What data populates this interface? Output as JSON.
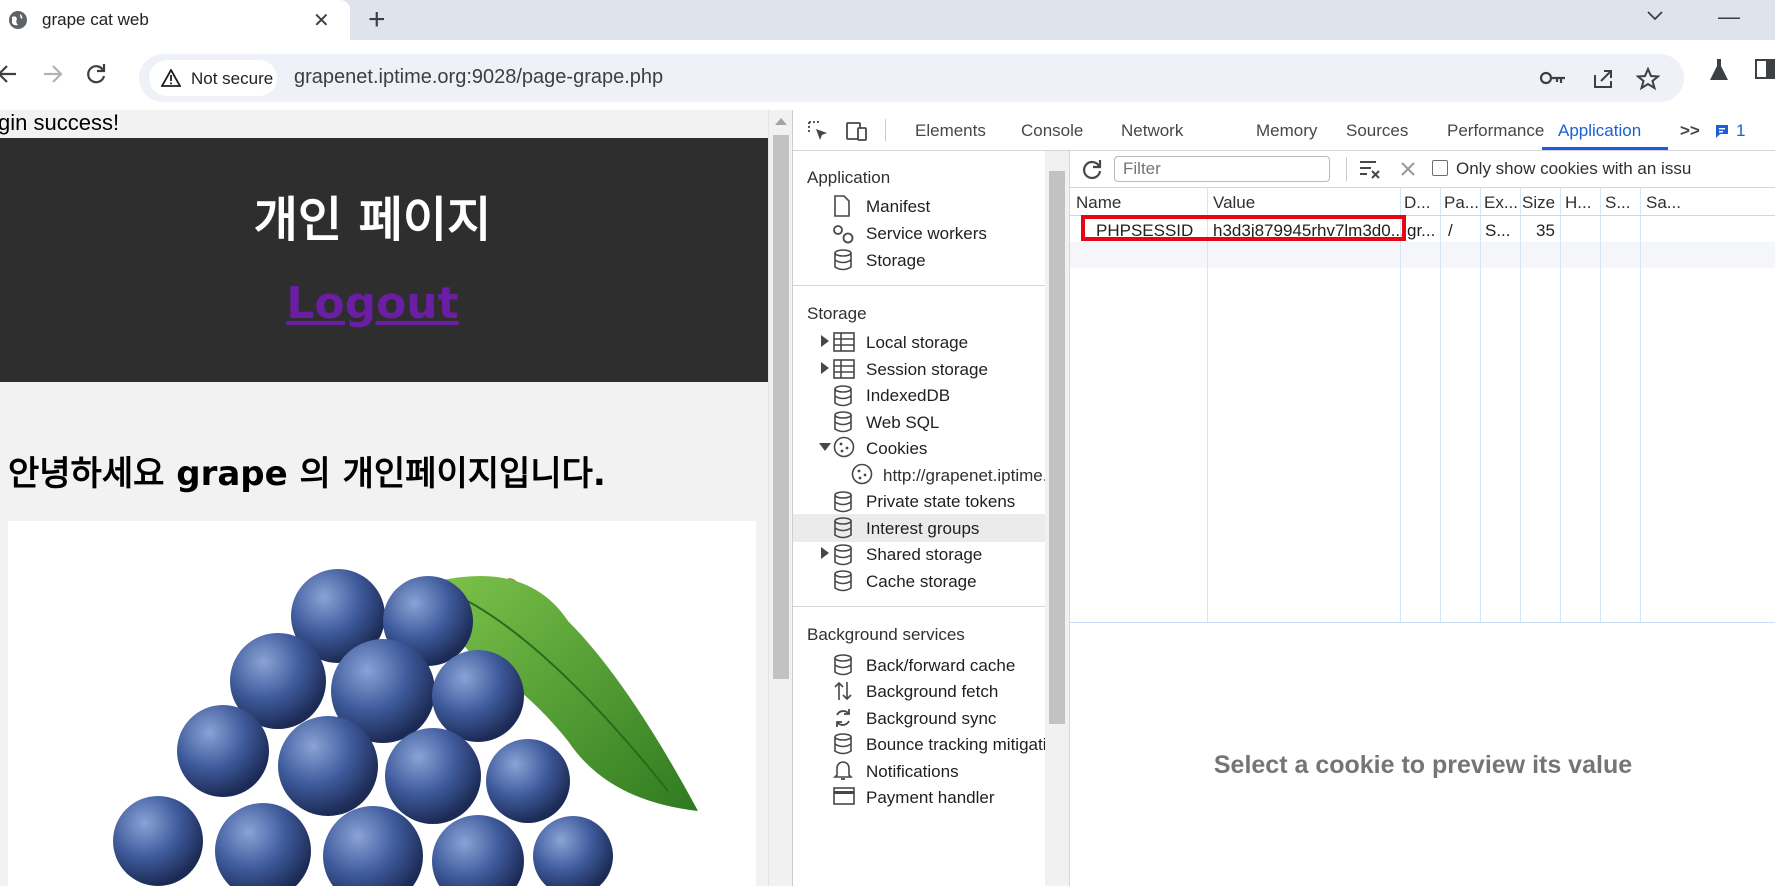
{
  "browser": {
    "tab_title": "grape cat web",
    "security_label": "Not secure",
    "url": "grapenet.iptime.org:9028/page-grape.php"
  },
  "page": {
    "login_message": "gin success!",
    "banner_title": "개인 페이지",
    "logout_link": "Logout",
    "greeting": "안녕하세요 grape 의 개인페이지입니다."
  },
  "devtools": {
    "tabs": [
      "Elements",
      "Console",
      "Network",
      "Memory",
      "Sources",
      "Performance",
      "Application"
    ],
    "active_tab": "Application",
    "more_tabs": ">>",
    "issues_count": "1",
    "sidebar": {
      "application_header": "Application",
      "application_items": [
        "Manifest",
        "Service workers",
        "Storage"
      ],
      "storage_header": "Storage",
      "storage_items": [
        "Local storage",
        "Session storage",
        "IndexedDB",
        "Web SQL",
        "Cookies",
        "http://grapenet.iptime.o",
        "Private state tokens",
        "Interest groups",
        "Shared storage",
        "Cache storage"
      ],
      "background_header": "Background services",
      "background_items": [
        "Back/forward cache",
        "Background fetch",
        "Background sync",
        "Bounce tracking mitigatio",
        "Notifications",
        "Payment handler"
      ]
    },
    "cookies": {
      "filter_placeholder": "Filter",
      "only_show_label": "Only show cookies with an issu",
      "columns": [
        "Name",
        "Value",
        "D...",
        "Pa...",
        "Ex...",
        "Size",
        "H...",
        "S...",
        "Sa..."
      ],
      "row": {
        "name": "PHPSESSID",
        "value": "h3d3j879945rhv7lm3d0...",
        "domain": "gr...",
        "path": "/",
        "expires": "S...",
        "size": "35"
      },
      "preview_text": "Select a cookie to preview its value"
    }
  },
  "colors": {
    "banner_bg": "#2e2e2e",
    "link_visited": "#6a1ea3",
    "devtools_accent": "#1a5fd6",
    "highlight_box": "#e8050f"
  }
}
